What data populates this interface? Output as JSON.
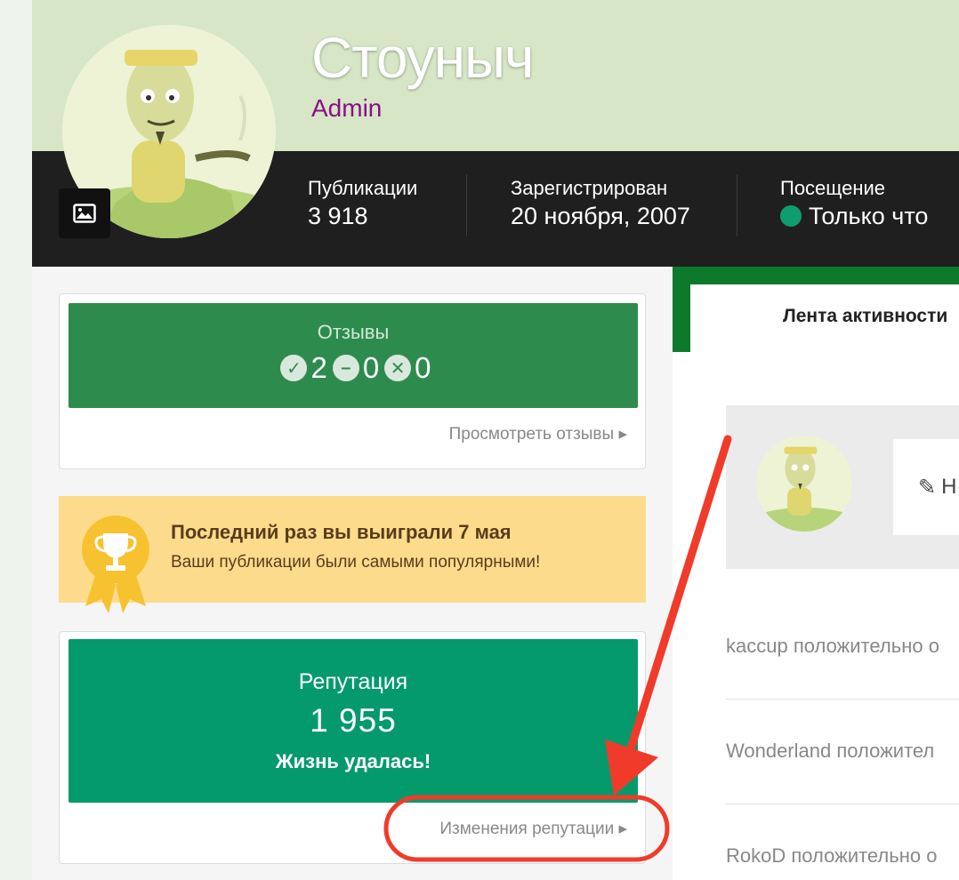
{
  "profile": {
    "name": "Стоуныч",
    "group": "Admin",
    "stats": [
      {
        "label": "Публикации",
        "value": "3 918"
      },
      {
        "label": "Зарегистрирован",
        "value": "20 ноября, 2007"
      },
      {
        "label": "Посещение",
        "value": "Только что",
        "status_color": "#0f9c6e"
      }
    ]
  },
  "feedback": {
    "title": "Отзывы",
    "positive": "2",
    "neutral": "0",
    "negative": "0",
    "link": "Просмотреть отзывы ▸"
  },
  "award": {
    "title": "Последний раз вы выиграли 7 мая",
    "subtitle": "Ваши публикации были самыми популярными!"
  },
  "reputation": {
    "title": "Репутация",
    "value": "1 955",
    "rank": "Жизнь удалась!",
    "link": "Изменения репутации ▸"
  },
  "activity": {
    "tab_label": "Лента активности",
    "status_placeholder": "Н",
    "items": [
      "kaccup положительно о",
      "Wonderland положител",
      "RokoD положительно о"
    ]
  },
  "colors": {
    "feedback_green": "#2e8b4e",
    "reputation_green": "#059a6c",
    "award_bg": "#fcdc8c",
    "annotation_red": "#f03b2b"
  }
}
